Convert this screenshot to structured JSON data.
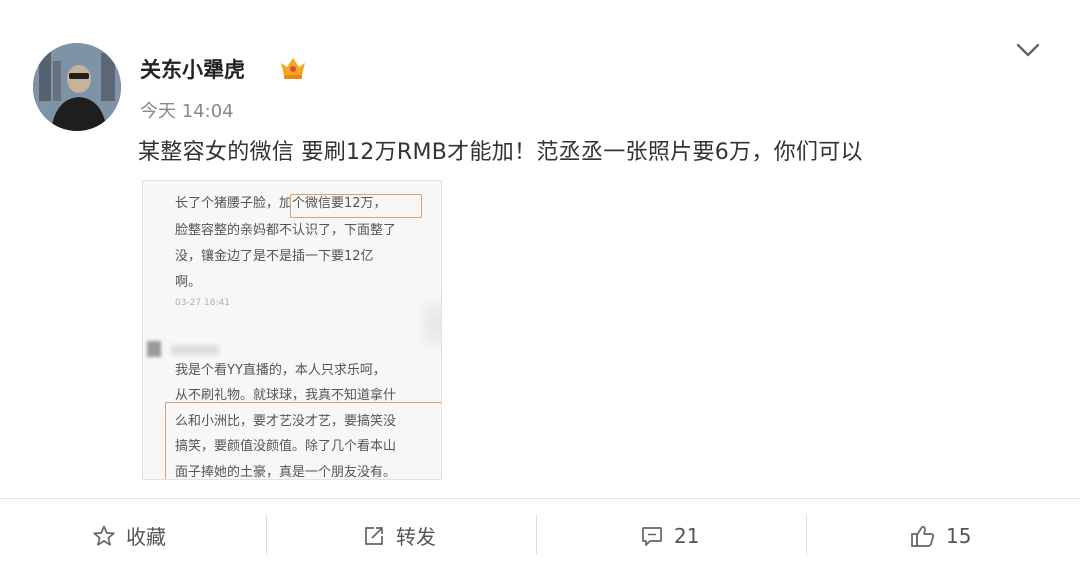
{
  "post": {
    "username": "关东小犟虎",
    "timestamp": "今天 14:04",
    "text": "某整容女的微信  要刷12万RMB才能加！范丞丞一张照片要6万，你们可以"
  },
  "image": {
    "lines_top": [
      "长了个猪腰子脸，加个微信要12万，",
      "脸整容整的亲妈都不认识了，下面整了",
      "没，镶金边了是不是插一下要12亿",
      "啊。"
    ],
    "meta_time": "03-27 18:41",
    "lines_bottom": [
      "我是个看YY直播的，本人只求乐呵，",
      "从不刷礼物。就球球，我真不知道拿什",
      "么和小洲比，要才艺没才艺，要搞笑没",
      "搞笑，要颜值没颜值。除了几个看本山",
      "面子捧她的土豪，真是一个朋友没有。"
    ]
  },
  "actions": {
    "favorite_label": "收藏",
    "repost_label": "转发",
    "comment_count": "21",
    "like_count": "15"
  },
  "colors": {
    "highlight_box": "#e0a16c",
    "text_main": "#333333",
    "text_muted": "#888888"
  }
}
